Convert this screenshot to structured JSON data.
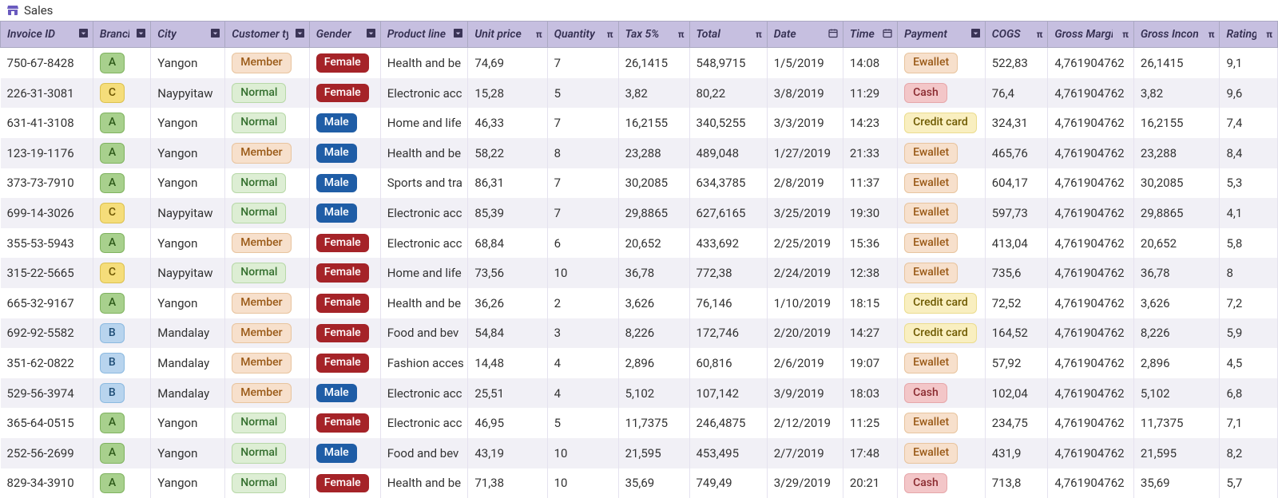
{
  "title": "Sales",
  "columns": [
    {
      "key": "invoice",
      "label": "Invoice ID",
      "icon": "dropdown",
      "cls": "col-invoice"
    },
    {
      "key": "branch",
      "label": "Branch",
      "icon": "dropdown",
      "cls": "col-branch",
      "badge": "branch"
    },
    {
      "key": "city",
      "label": "City",
      "icon": "dropdown",
      "cls": "col-city"
    },
    {
      "key": "customer",
      "label": "Customer ty",
      "icon": "dropdown",
      "cls": "col-cust",
      "badge": "cust"
    },
    {
      "key": "gender",
      "label": "Gender",
      "icon": "dropdown",
      "cls": "col-gender",
      "badge": "gender"
    },
    {
      "key": "product",
      "label": "Product line",
      "icon": "dropdown",
      "cls": "col-product"
    },
    {
      "key": "unit_price",
      "label": "Unit price",
      "icon": "pi",
      "cls": "col-unit"
    },
    {
      "key": "quantity",
      "label": "Quantity",
      "icon": "pi",
      "cls": "col-qty"
    },
    {
      "key": "tax",
      "label": "Tax 5%",
      "icon": "pi",
      "cls": "col-tax"
    },
    {
      "key": "total",
      "label": "Total",
      "icon": "pi",
      "cls": "col-total"
    },
    {
      "key": "date",
      "label": "Date",
      "icon": "calendar",
      "cls": "col-date"
    },
    {
      "key": "time",
      "label": "Time",
      "icon": "calendar",
      "cls": "col-time"
    },
    {
      "key": "payment",
      "label": "Payment",
      "icon": "dropdown",
      "cls": "col-payment",
      "badge": "pay"
    },
    {
      "key": "cogs",
      "label": "COGS",
      "icon": "pi",
      "cls": "col-cogs"
    },
    {
      "key": "gross_margin",
      "label": "Gross Margi.",
      "icon": "pi",
      "cls": "col-gm"
    },
    {
      "key": "gross_income",
      "label": "Gross Incom",
      "icon": "pi",
      "cls": "col-gi"
    },
    {
      "key": "rating",
      "label": "Rating",
      "icon": "pi",
      "cls": "col-rating"
    }
  ],
  "icons": {
    "dropdown": "▾",
    "pi": "π",
    "calendar": "📅"
  },
  "rows": [
    {
      "invoice": "750-67-8428",
      "branch": "A",
      "city": "Yangon",
      "customer": "Member",
      "gender": "Female",
      "product": "Health and be",
      "unit_price": "74,69",
      "quantity": "7",
      "tax": "26,1415",
      "total": "548,9715",
      "date": "1/5/2019",
      "time": "14:08",
      "payment": "Ewallet",
      "cogs": "522,83",
      "gross_margin": "4,761904762",
      "gross_income": "26,1415",
      "rating": "9,1"
    },
    {
      "invoice": "226-31-3081",
      "branch": "C",
      "city": "Naypyitaw",
      "customer": "Normal",
      "gender": "Female",
      "product": "Electronic acc",
      "unit_price": "15,28",
      "quantity": "5",
      "tax": "3,82",
      "total": "80,22",
      "date": "3/8/2019",
      "time": "11:29",
      "payment": "Cash",
      "cogs": "76,4",
      "gross_margin": "4,761904762",
      "gross_income": "3,82",
      "rating": "9,6"
    },
    {
      "invoice": "631-41-3108",
      "branch": "A",
      "city": "Yangon",
      "customer": "Normal",
      "gender": "Male",
      "product": "Home and life",
      "unit_price": "46,33",
      "quantity": "7",
      "tax": "16,2155",
      "total": "340,5255",
      "date": "3/3/2019",
      "time": "14:23",
      "payment": "Credit card",
      "cogs": "324,31",
      "gross_margin": "4,761904762",
      "gross_income": "16,2155",
      "rating": "7,4"
    },
    {
      "invoice": "123-19-1176",
      "branch": "A",
      "city": "Yangon",
      "customer": "Member",
      "gender": "Male",
      "product": "Health and be",
      "unit_price": "58,22",
      "quantity": "8",
      "tax": "23,288",
      "total": "489,048",
      "date": "1/27/2019",
      "time": "21:33",
      "payment": "Ewallet",
      "cogs": "465,76",
      "gross_margin": "4,761904762",
      "gross_income": "23,288",
      "rating": "8,4"
    },
    {
      "invoice": "373-73-7910",
      "branch": "A",
      "city": "Yangon",
      "customer": "Normal",
      "gender": "Male",
      "product": "Sports and tra",
      "unit_price": "86,31",
      "quantity": "7",
      "tax": "30,2085",
      "total": "634,3785",
      "date": "2/8/2019",
      "time": "11:37",
      "payment": "Ewallet",
      "cogs": "604,17",
      "gross_margin": "4,761904762",
      "gross_income": "30,2085",
      "rating": "5,3"
    },
    {
      "invoice": "699-14-3026",
      "branch": "C",
      "city": "Naypyitaw",
      "customer": "Normal",
      "gender": "Male",
      "product": "Electronic acc",
      "unit_price": "85,39",
      "quantity": "7",
      "tax": "29,8865",
      "total": "627,6165",
      "date": "3/25/2019",
      "time": "19:30",
      "payment": "Ewallet",
      "cogs": "597,73",
      "gross_margin": "4,761904762",
      "gross_income": "29,8865",
      "rating": "4,1"
    },
    {
      "invoice": "355-53-5943",
      "branch": "A",
      "city": "Yangon",
      "customer": "Member",
      "gender": "Female",
      "product": "Electronic acc",
      "unit_price": "68,84",
      "quantity": "6",
      "tax": "20,652",
      "total": "433,692",
      "date": "2/25/2019",
      "time": "15:36",
      "payment": "Ewallet",
      "cogs": "413,04",
      "gross_margin": "4,761904762",
      "gross_income": "20,652",
      "rating": "5,8"
    },
    {
      "invoice": "315-22-5665",
      "branch": "C",
      "city": "Naypyitaw",
      "customer": "Normal",
      "gender": "Female",
      "product": "Home and life",
      "unit_price": "73,56",
      "quantity": "10",
      "tax": "36,78",
      "total": "772,38",
      "date": "2/24/2019",
      "time": "12:38",
      "payment": "Ewallet",
      "cogs": "735,6",
      "gross_margin": "4,761904762",
      "gross_income": "36,78",
      "rating": "8"
    },
    {
      "invoice": "665-32-9167",
      "branch": "A",
      "city": "Yangon",
      "customer": "Member",
      "gender": "Female",
      "product": "Health and be",
      "unit_price": "36,26",
      "quantity": "2",
      "tax": "3,626",
      "total": "76,146",
      "date": "1/10/2019",
      "time": "18:15",
      "payment": "Credit card",
      "cogs": "72,52",
      "gross_margin": "4,761904762",
      "gross_income": "3,626",
      "rating": "7,2"
    },
    {
      "invoice": "692-92-5582",
      "branch": "B",
      "city": "Mandalay",
      "customer": "Member",
      "gender": "Female",
      "product": "Food and bev",
      "unit_price": "54,84",
      "quantity": "3",
      "tax": "8,226",
      "total": "172,746",
      "date": "2/20/2019",
      "time": "14:27",
      "payment": "Credit card",
      "cogs": "164,52",
      "gross_margin": "4,761904762",
      "gross_income": "8,226",
      "rating": "5,9"
    },
    {
      "invoice": "351-62-0822",
      "branch": "B",
      "city": "Mandalay",
      "customer": "Member",
      "gender": "Female",
      "product": "Fashion acces",
      "unit_price": "14,48",
      "quantity": "4",
      "tax": "2,896",
      "total": "60,816",
      "date": "2/6/2019",
      "time": "19:07",
      "payment": "Ewallet",
      "cogs": "57,92",
      "gross_margin": "4,761904762",
      "gross_income": "2,896",
      "rating": "4,5"
    },
    {
      "invoice": "529-56-3974",
      "branch": "B",
      "city": "Mandalay",
      "customer": "Member",
      "gender": "Male",
      "product": "Electronic acc",
      "unit_price": "25,51",
      "quantity": "4",
      "tax": "5,102",
      "total": "107,142",
      "date": "3/9/2019",
      "time": "18:03",
      "payment": "Cash",
      "cogs": "102,04",
      "gross_margin": "4,761904762",
      "gross_income": "5,102",
      "rating": "6,8"
    },
    {
      "invoice": "365-64-0515",
      "branch": "A",
      "city": "Yangon",
      "customer": "Normal",
      "gender": "Female",
      "product": "Electronic acc",
      "unit_price": "46,95",
      "quantity": "5",
      "tax": "11,7375",
      "total": "246,4875",
      "date": "2/12/2019",
      "time": "11:25",
      "payment": "Ewallet",
      "cogs": "234,75",
      "gross_margin": "4,761904762",
      "gross_income": "11,7375",
      "rating": "7,1"
    },
    {
      "invoice": "252-56-2699",
      "branch": "A",
      "city": "Yangon",
      "customer": "Normal",
      "gender": "Male",
      "product": "Food and bev",
      "unit_price": "43,19",
      "quantity": "10",
      "tax": "21,595",
      "total": "453,495",
      "date": "2/7/2019",
      "time": "17:48",
      "payment": "Ewallet",
      "cogs": "431,9",
      "gross_margin": "4,761904762",
      "gross_income": "21,595",
      "rating": "8,2"
    },
    {
      "invoice": "829-34-3910",
      "branch": "A",
      "city": "Yangon",
      "customer": "Normal",
      "gender": "Female",
      "product": "Health and be",
      "unit_price": "71,38",
      "quantity": "10",
      "tax": "35,69",
      "total": "749,49",
      "date": "3/29/2019",
      "time": "20:21",
      "payment": "Cash",
      "cogs": "713,8",
      "gross_margin": "4,761904762",
      "gross_income": "35,69",
      "rating": "5,7"
    }
  ]
}
